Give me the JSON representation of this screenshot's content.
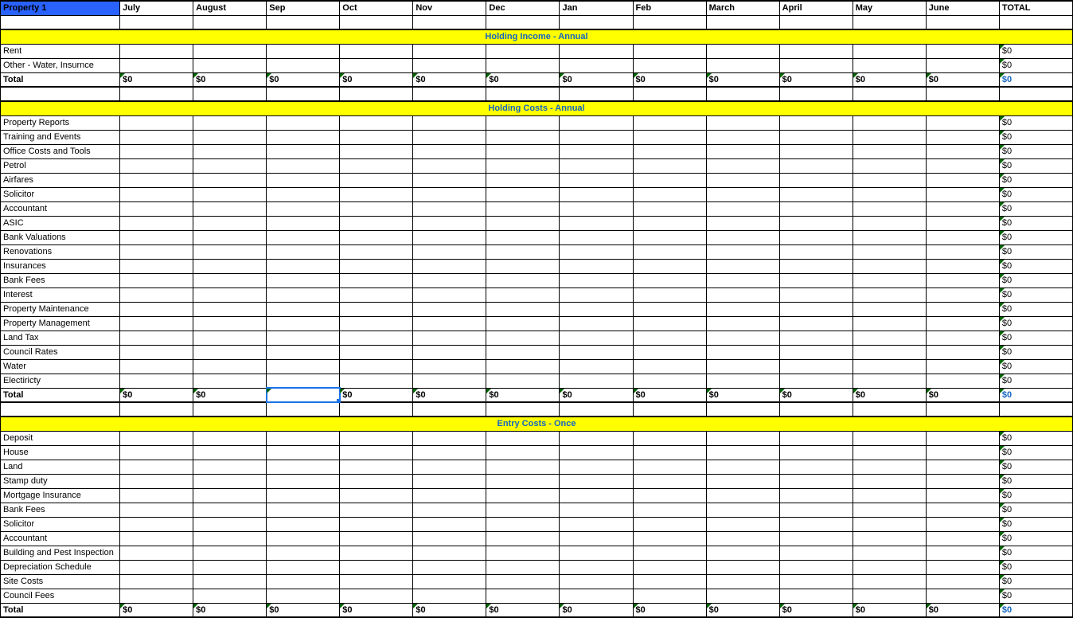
{
  "header": {
    "property": "Property 1",
    "months": [
      "July",
      "August",
      "Sep",
      "Oct",
      "Nov",
      "Dec",
      "Jan",
      "Feb",
      "March",
      "April",
      "May",
      "June"
    ],
    "total": "TOTAL"
  },
  "zero": "$0",
  "totalLabel": "Total",
  "sections": [
    {
      "title": "Holding Income - Annual",
      "rows": [
        "Rent",
        "Other - Water, Insurnce"
      ]
    },
    {
      "title": "Holding Costs - Annual",
      "rows": [
        "Property Reports",
        "Training and Events",
        "Office Costs and Tools",
        "Petrol",
        "Airfares",
        "Solicitor",
        "Accountant",
        "ASIC",
        "Bank Valuations",
        "Renovations",
        "Insurances",
        "Bank Fees",
        "Interest",
        "Property Maintenance",
        "Property Management",
        "Land Tax",
        "Council Rates",
        "Water",
        "Electiricty"
      ]
    },
    {
      "title": "Entry Costs - Once",
      "rows": [
        "Deposit",
        "House",
        "Land",
        "Stamp duty",
        "Mortgage Insurance",
        "Bank Fees",
        "Solicitor",
        "Accountant",
        "Building and Pest Inspection",
        "Depreciation Schedule",
        "Site Costs",
        "Council Fees"
      ]
    }
  ],
  "selectedCell": {
    "section": 1,
    "row": "total",
    "colIndex": 3
  }
}
